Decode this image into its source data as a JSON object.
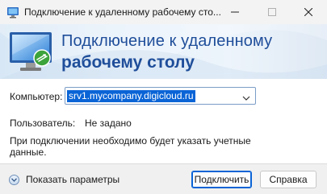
{
  "window": {
    "title": "Подключение к удаленному рабочему сто...",
    "colors": {
      "banner_text": "#1f4e9a",
      "selection": "#0a64d6"
    }
  },
  "banner": {
    "line1": "Подключение к удаленному",
    "line2": "рабочему столу",
    "icon": "remote-desktop-monitor-icon"
  },
  "form": {
    "computer_label": "Компьютер:",
    "computer_value": "srv1.mycompany.digicloud.ru",
    "user_label": "Пользователь:",
    "user_value": "Не задано",
    "note": "При подключении необходимо будет указать учетные данные."
  },
  "footer": {
    "show_options_label": "Показать параметры",
    "connect_label": "Подключить",
    "help_label": "Справка"
  }
}
